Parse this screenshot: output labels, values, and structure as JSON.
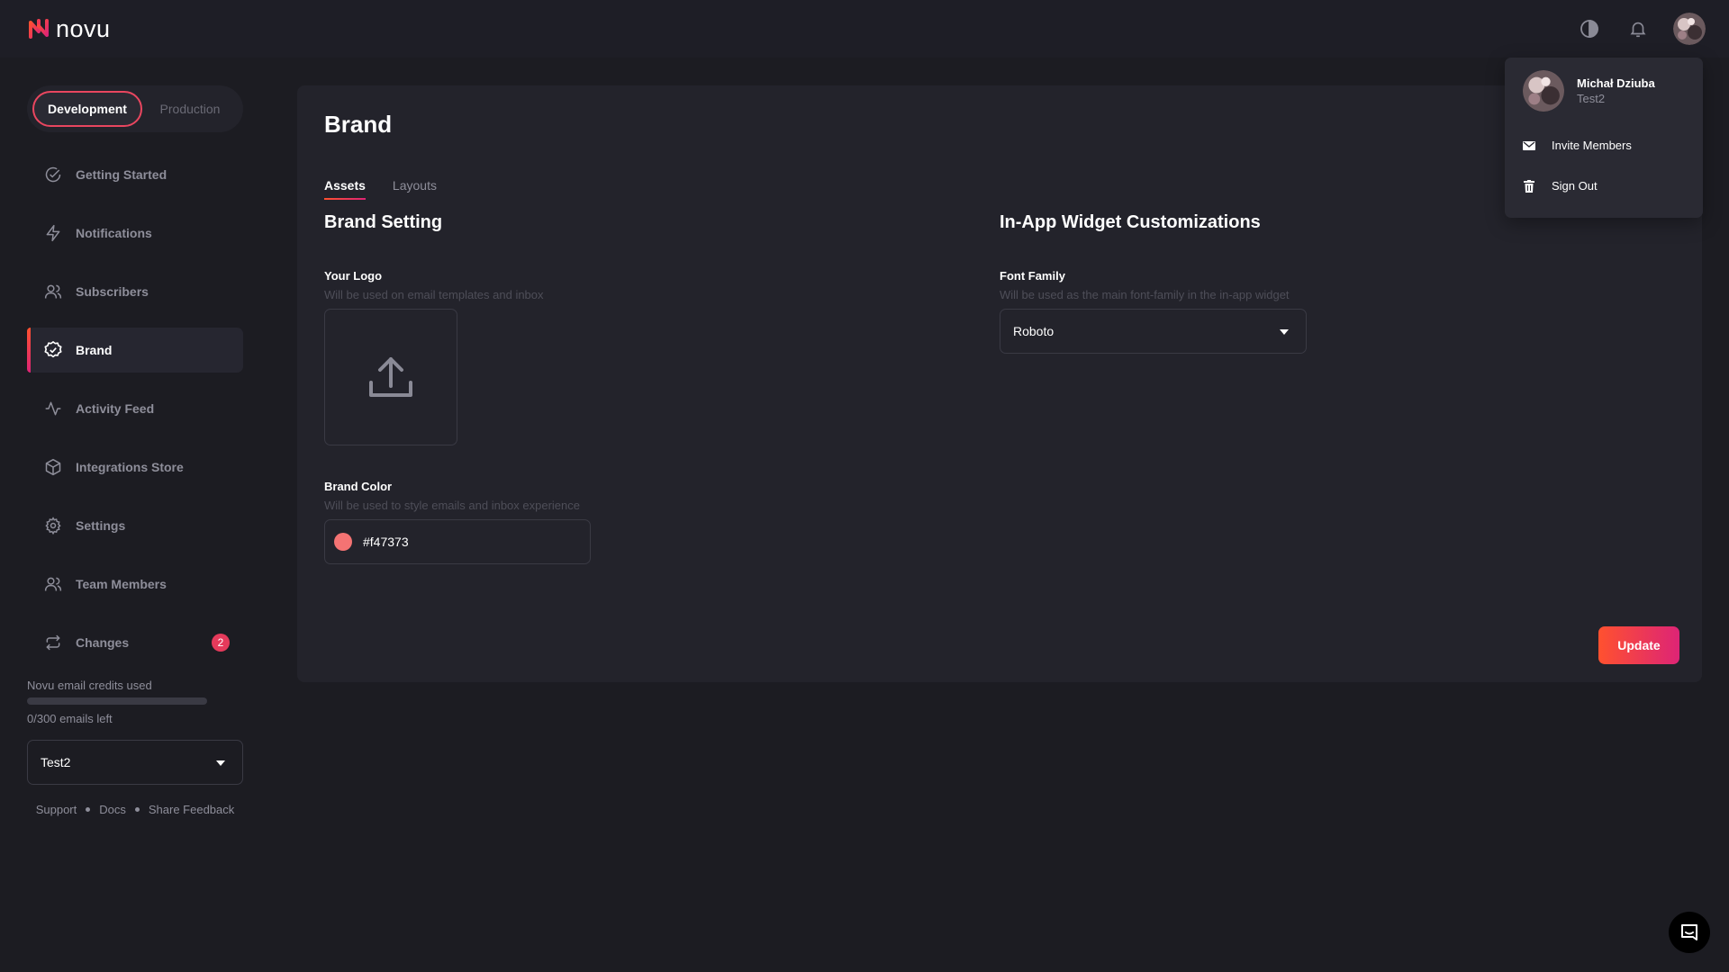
{
  "app": {
    "name": "novu"
  },
  "header": {
    "theme_toggle_icon": "theme-toggle-icon",
    "bell_icon": "bell-icon"
  },
  "environment": {
    "options": [
      "Development",
      "Production"
    ],
    "selected": "Development"
  },
  "sidebar": {
    "items": [
      {
        "label": "Getting Started",
        "icon": "check-circle-icon",
        "active": false
      },
      {
        "label": "Notifications",
        "icon": "bolt-icon",
        "active": false
      },
      {
        "label": "Subscribers",
        "icon": "users-icon",
        "active": false
      },
      {
        "label": "Brand",
        "icon": "badge-check-icon",
        "active": true
      },
      {
        "label": "Activity Feed",
        "icon": "activity-icon",
        "active": false
      },
      {
        "label": "Integrations Store",
        "icon": "box-icon",
        "active": false
      },
      {
        "label": "Settings",
        "icon": "gear-icon",
        "active": false
      },
      {
        "label": "Team Members",
        "icon": "users-icon",
        "active": false
      },
      {
        "label": "Changes",
        "icon": "repeat-icon",
        "active": false,
        "badge": "2"
      }
    ],
    "credits": {
      "label": "Novu email credits used",
      "used": 0,
      "total": 300,
      "left_text": "0/300 emails left"
    },
    "organization": "Test2",
    "footer_links": [
      "Support",
      "Docs",
      "Share Feedback"
    ]
  },
  "main": {
    "title": "Brand",
    "tabs": [
      {
        "label": "Assets",
        "active": true
      },
      {
        "label": "Layouts",
        "active": false
      }
    ],
    "brand_setting": {
      "title": "Brand Setting",
      "logo_label": "Your Logo",
      "logo_desc": "Will be used on email templates and inbox",
      "color_label": "Brand Color",
      "color_desc": "Will be used to style emails and inbox experience",
      "color_value": "#f47373"
    },
    "widget": {
      "title": "In-App Widget Customizations",
      "font_label": "Font Family",
      "font_desc": "Will be used as the main font-family in the in-app widget",
      "font_value": "Roboto"
    },
    "update_label": "Update"
  },
  "user_menu": {
    "name": "Michał Dziuba",
    "org": "Test2",
    "items": [
      {
        "label": "Invite Members",
        "icon": "mail-icon"
      },
      {
        "label": "Sign Out",
        "icon": "trash-icon"
      }
    ]
  },
  "colors": {
    "accent_start": "#ff512f",
    "accent_end": "#dd2476",
    "brand_color": "#f47373",
    "badge": "#e53a5b"
  }
}
